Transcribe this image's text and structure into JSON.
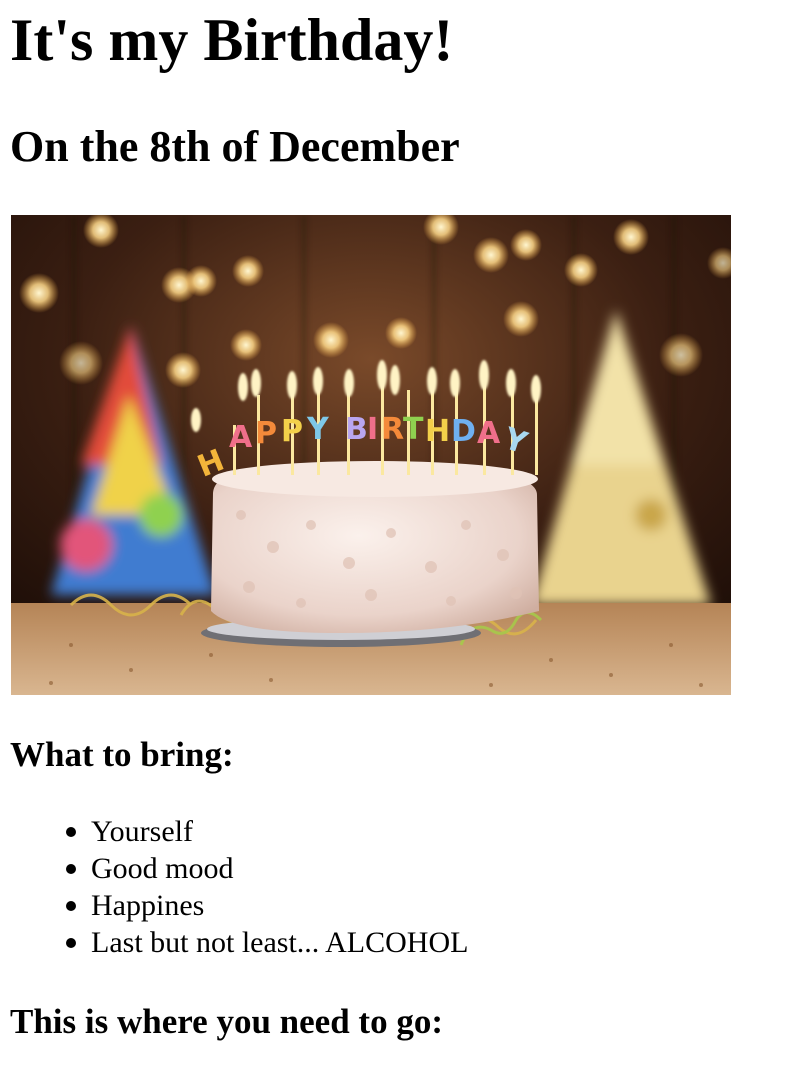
{
  "page": {
    "title": "It's my Birthday!",
    "subtitle": "On the 8th of December"
  },
  "photo": {
    "alt": "Birthday cake with HAPPY BIRTHDAY candles and party hats"
  },
  "bring": {
    "heading": "What to bring:",
    "items": [
      "Yourself",
      "Good mood",
      "Happines",
      "Last but not least... ALCOHOL"
    ]
  },
  "directions": {
    "heading": "This is where you need to go:"
  },
  "colors": {
    "background": "#ffffff",
    "text": "#000000"
  }
}
